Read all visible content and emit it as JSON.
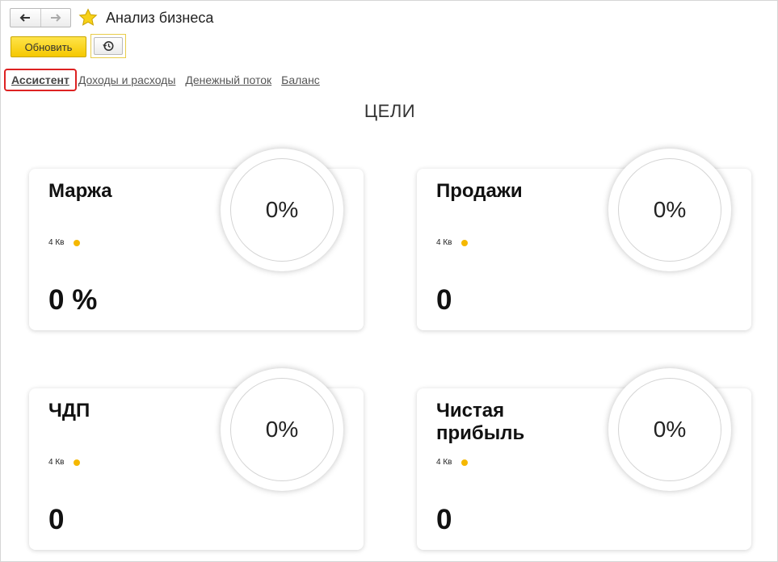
{
  "header": {
    "title": "Анализ бизнеса",
    "refresh_label": "Обновить"
  },
  "tabs": [
    {
      "label": "Ассистент"
    },
    {
      "label": "Доходы и расходы"
    },
    {
      "label": "Денежный поток"
    },
    {
      "label": "Баланс"
    }
  ],
  "section_title": "ЦЕЛИ",
  "cards": [
    {
      "title": "Маржа",
      "period": "4 Кв",
      "value": "0 %",
      "percent": "0%"
    },
    {
      "title": "Продажи",
      "period": "4 Кв",
      "value": "0",
      "percent": "0%"
    },
    {
      "title": "ЧДП",
      "period": "4 Кв",
      "value": "0",
      "percent": "0%"
    },
    {
      "title": "Чистая прибыль",
      "period": "4 Кв",
      "value": "0",
      "percent": "0%"
    }
  ],
  "colors": {
    "accent_yellow": "#f5c800",
    "active_tab_border": "#dd2222",
    "dot": "#f5b800"
  }
}
